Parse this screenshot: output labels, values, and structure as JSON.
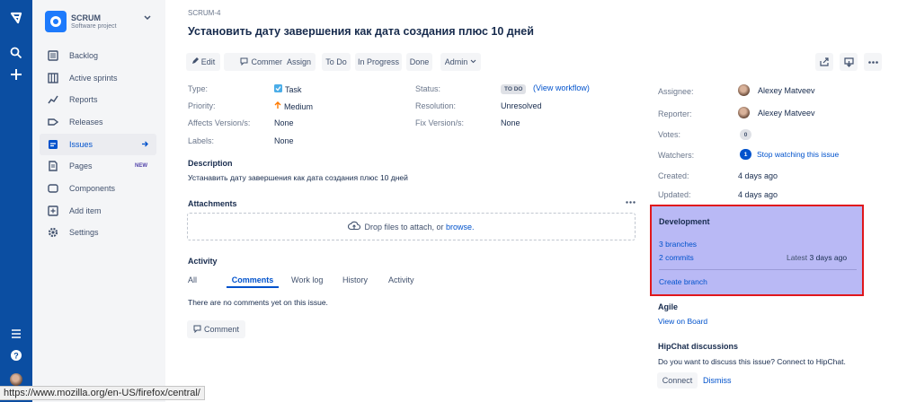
{
  "project": {
    "name": "SCRUM",
    "type": "Software project"
  },
  "sidebar": {
    "items": [
      {
        "label": "Backlog",
        "icon": "backlog-icon"
      },
      {
        "label": "Active sprints",
        "icon": "board-icon"
      },
      {
        "label": "Reports",
        "icon": "reports-icon"
      },
      {
        "label": "Releases",
        "icon": "releases-icon"
      },
      {
        "label": "Issues",
        "icon": "issues-icon"
      },
      {
        "label": "Pages",
        "icon": "pages-icon",
        "badge": "NEW"
      },
      {
        "label": "Components",
        "icon": "components-icon"
      },
      {
        "label": "Add item",
        "icon": "add-item-icon"
      },
      {
        "label": "Settings",
        "icon": "settings-icon"
      }
    ]
  },
  "issue": {
    "key": "SCRUM-4",
    "title": "Установить дату завершения как дата создания плюс 10 дней",
    "toolbar": {
      "edit": "Edit",
      "comment": "Comment",
      "assign": "Assign",
      "todo": "To Do",
      "inprogress": "In Progress",
      "done": "Done",
      "admin": "Admin"
    },
    "details": {
      "type_label": "Type:",
      "type_value": "Task",
      "priority_label": "Priority:",
      "priority_value": "Medium",
      "affects_label": "Affects Version/s:",
      "affects_value": "None",
      "labels_label": "Labels:",
      "labels_value": "None",
      "status_label": "Status:",
      "status_value": "TO DO",
      "view_workflow": "(View workflow)",
      "resolution_label": "Resolution:",
      "resolution_value": "Unresolved",
      "fix_label": "Fix Version/s:",
      "fix_value": "None"
    },
    "description_heading": "Description",
    "description": "Устанавить дату завершения как дата создания плюс 10 дней",
    "attachments_heading": "Attachments",
    "drop_text": "Drop files to attach, or",
    "browse": "browse.",
    "activity_heading": "Activity",
    "activity_tabs": [
      "All",
      "Comments",
      "Work log",
      "History",
      "Activity"
    ],
    "no_comments": "There are no comments yet on this issue.",
    "comment_button": "Comment"
  },
  "people": {
    "assignee_label": "Assignee:",
    "assignee": "Alexey Matveev",
    "reporter_label": "Reporter:",
    "reporter": "Alexey Matveev",
    "votes_label": "Votes:",
    "votes": "0",
    "watchers_label": "Watchers:",
    "watchers": "1",
    "stop_watching": "Stop watching this issue"
  },
  "dates": {
    "created_label": "Created:",
    "created": "4 days ago",
    "updated_label": "Updated:",
    "updated": "4 days ago"
  },
  "development": {
    "heading": "Development",
    "branches": "3 branches",
    "commits": "2 commits",
    "latest_label": "Latest",
    "latest": "3 days ago",
    "create_branch": "Create branch",
    "highlight_color": "#b9b9f5",
    "border_color": "#e0171c"
  },
  "agile": {
    "heading": "Agile",
    "view_on_board": "View on Board"
  },
  "hipchat": {
    "heading": "HipChat discussions",
    "text": "Do you want to discuss this issue? Connect to HipChat.",
    "connect": "Connect",
    "dismiss": "Dismiss"
  },
  "statusbar": {
    "url": "https://www.mozilla.org/en-US/firefox/central/"
  }
}
